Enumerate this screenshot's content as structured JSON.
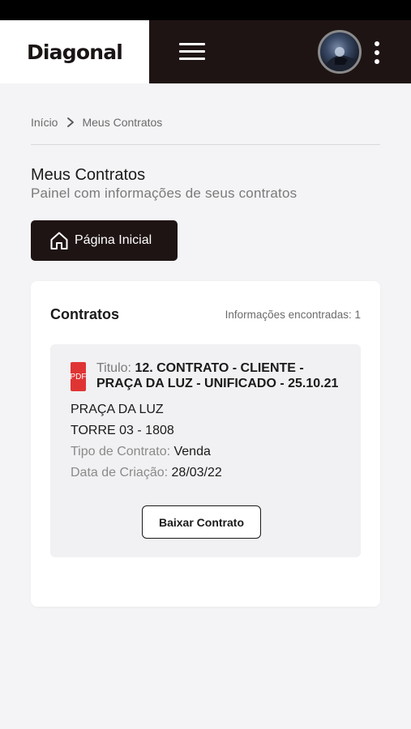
{
  "header": {
    "logo_text": "Diagonal",
    "menu_icon": "hamburger-menu-icon",
    "avatar": "user-avatar",
    "more_icon": "kebab-menu-icon"
  },
  "breadcrumb": {
    "home": "Início",
    "separator_icon": "chevron-right-icon",
    "current": "Meus Contratos"
  },
  "page": {
    "title": "Meus Contratos",
    "subtitle": "Painel com informações de seus contratos"
  },
  "home_button": {
    "icon": "home-icon",
    "label": "Página Inicial"
  },
  "contracts": {
    "title": "Contratos",
    "count_text": "Informações encontradas: 1",
    "items": [
      {
        "file_badge": "PDF",
        "title_key": "Titulo:",
        "title_value": "12. CONTRATO - CLIENTE - PRAÇA DA LUZ - UNIFICADO - 25.10.21",
        "line1": "PRAÇA DA LUZ",
        "line2": "TORRE 03 - 1808",
        "type_key": "Tipo de Contrato:",
        "type_value": "Venda",
        "date_key": "Data de Criação:",
        "date_value": "28/03/22",
        "download_label": "Baixar Contrato"
      }
    ]
  },
  "colors": {
    "header_bg": "#1f1414",
    "page_bg": "#f4f4f6",
    "pdf_red": "#e03434"
  }
}
